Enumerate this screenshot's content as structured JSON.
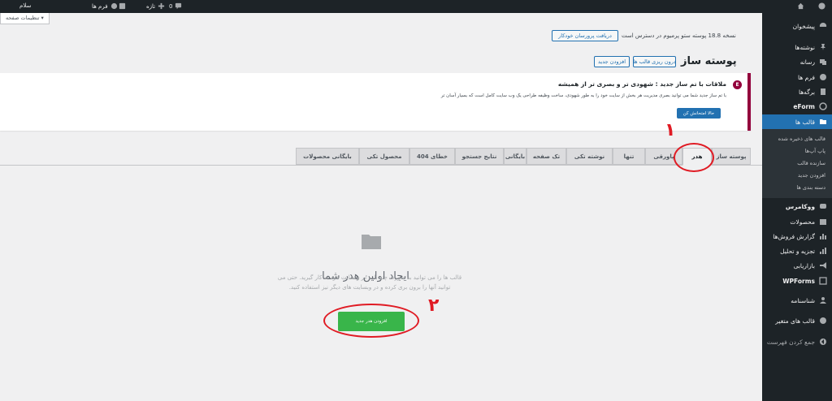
{
  "adminbar": {
    "site": "سلام",
    "updates": "0",
    "new": "تازه",
    "forms": "فرم ها"
  },
  "sidebar": {
    "items": [
      {
        "label": "پیشخوان",
        "icon": "dashboard-icon"
      },
      {
        "label": "نوشته‌ها",
        "icon": "pin-icon"
      },
      {
        "label": "رسانه",
        "icon": "media-icon"
      },
      {
        "label": "فرم ها",
        "icon": "forms-icon"
      },
      {
        "label": "برگه‌ها",
        "icon": "page-icon"
      },
      {
        "label": "eForm",
        "icon": "eform-icon"
      },
      {
        "label": "قالب ها",
        "icon": "folder-icon"
      }
    ],
    "submenu": [
      "قالب های ذخیره شده",
      "پاپ آپ‌ها",
      "سازنده قالب",
      "افزودن جدید",
      "دسته بندی ها"
    ],
    "items2": [
      {
        "label": "ووکامرس",
        "icon": "woo-icon"
      },
      {
        "label": "محصولات",
        "icon": "products-icon"
      },
      {
        "label": "گزارش فروش‌ها",
        "icon": "report-icon"
      },
      {
        "label": "تجزیه و تحلیل",
        "icon": "analytics-icon"
      },
      {
        "label": "بازاریابی",
        "icon": "megaphone-icon"
      },
      {
        "label": "WPForms",
        "icon": "wpforms-icon"
      },
      {
        "label": "شناسنامه",
        "icon": "user-icon"
      },
      {
        "label": "قالب های متغیر",
        "icon": "globe-icon"
      },
      {
        "label": "جمع کردن فهرست",
        "icon": "collapse-icon"
      }
    ]
  },
  "screen_options": "تنظیمات صفحه ▾",
  "version_notice": "نسخه 18.8 پوسته ستو پرمیوم در دسترس است",
  "get_pro_btn": "دریافت پرورسان خودکار",
  "page_title": "پوسته ساز",
  "add_new_btn": "افزودن جدید",
  "import_btn": "درون ریزی قالب ها",
  "notice": {
    "logo": "E",
    "title": "ملاقات با تم ساز جدید : شهودی تر و بصری تر از همیشه",
    "text": "با تم ساز جدید شما می توانید بصری مدیریت هر بخش از سایت خود را به طور شهودی، ساخت وظیفه طراحی یک وب سایت کامل است که بسیار آسان تر",
    "button": "حالا امتحانش کن"
  },
  "tabs": [
    "پوسته ساز",
    "هدر",
    "پاورقی",
    "تنها",
    "نوشته تکی",
    "تک صفحه",
    "بایگانی",
    "نتایج جستجو",
    "خطای 404",
    "محصول تکی",
    "بایگانی محصولات"
  ],
  "empty_state": {
    "title": "ایجاد اولین هدر شما",
    "line1": "قالب ها را می توانید به صورت چند باره در وبسایت خود به کار گیرید. حتی می",
    "line2": "توانید آنها را برون بری کرده و در وبسایت های دیگر نیز استفاده کنید.",
    "button": "افزودن هدر جدید"
  },
  "annotations": {
    "one": "۱",
    "two": "۲"
  }
}
